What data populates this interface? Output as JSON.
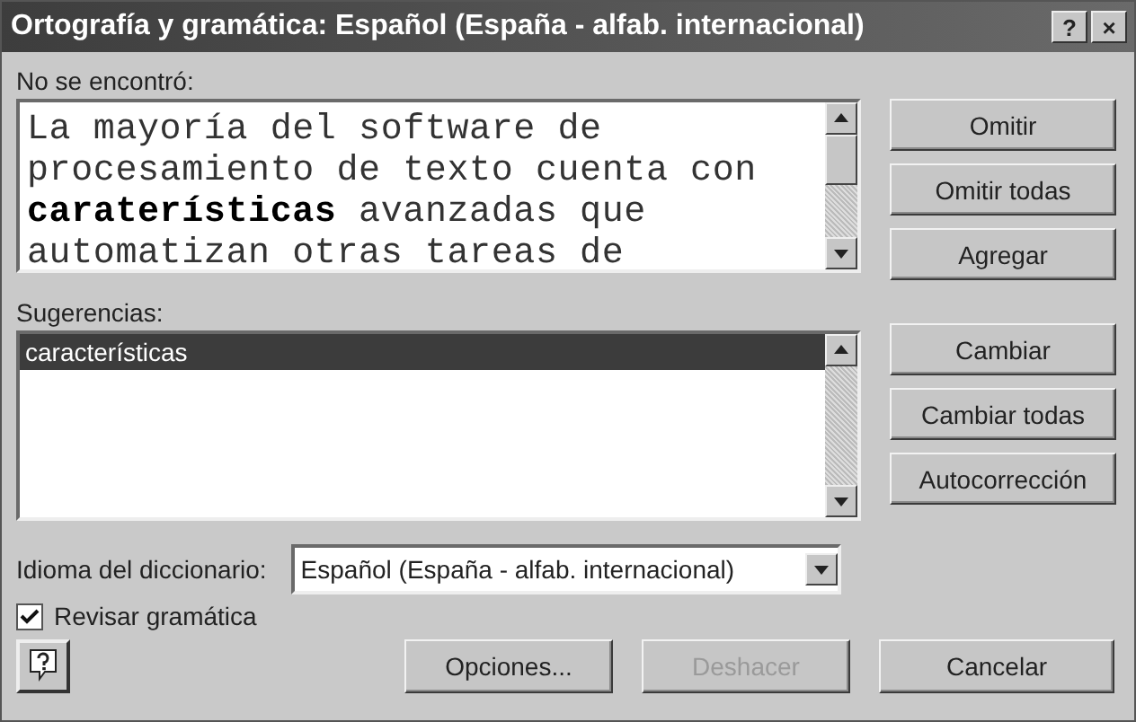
{
  "window": {
    "title": "Ortografía y gramática: Español (España - alfab. internacional)",
    "title_buttons": [
      "?",
      "×"
    ]
  },
  "not_found": {
    "label": "No se encontró:",
    "lines": [
      "La mayoría del software de",
      "procesamiento de texto cuenta con",
      "**caraterísticas** avanzadas que",
      "automatizan otras tareas de"
    ]
  },
  "top_buttons": [
    {
      "label": "Omitir",
      "disabled": false
    },
    {
      "label": "Omitir todas",
      "disabled": false
    },
    {
      "label": "Agregar",
      "disabled": false
    }
  ],
  "suggestions": {
    "label": "Sugerencias:",
    "items": [
      {
        "text": "características",
        "selected": true
      }
    ]
  },
  "middle_buttons": [
    {
      "label": "Cambiar",
      "disabled": false
    },
    {
      "label": "Cambiar todas",
      "disabled": false
    },
    {
      "label": "Autocorrección",
      "disabled": false
    }
  ],
  "dictionary": {
    "label": "Idioma del diccionario:",
    "value": "Español (España - alfab. internacional)"
  },
  "check_grammar": {
    "label": "Revisar gramática",
    "checked": true
  },
  "bottom_buttons": [
    {
      "label": "Opciones...",
      "disabled": false
    },
    {
      "label": "Deshacer",
      "disabled": true
    },
    {
      "label": "Cancelar",
      "disabled": false
    }
  ]
}
